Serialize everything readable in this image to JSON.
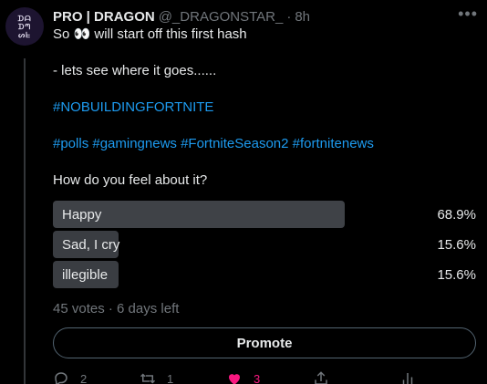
{
  "tweet": {
    "avatar_text": [
      "ᗪᗩ",
      "ᗪᘉ",
      "ᔕᖶ"
    ],
    "name": "PRO | DRAGON",
    "handle": "@_DRAGONSTAR_",
    "separator": "·",
    "time": "8h",
    "lines": [
      "So 👀 will start off this first hash",
      "",
      "- lets see where it goes......",
      ""
    ],
    "hashtag_line1": "#NOBUILDINGFORTNITE",
    "hashtag_line2": "#polls #gamingnews #FortniteSeason2  #fortnitenews",
    "question": "How do you feel about it?"
  },
  "poll": {
    "options": [
      {
        "label": "Happy",
        "percent_text": "68.9%",
        "percent": 68.9
      },
      {
        "label": "Sad, I cry",
        "percent_text": "15.6%",
        "percent": 15.6
      },
      {
        "label": "illegible",
        "percent_text": "15.6%",
        "percent": 15.6
      }
    ],
    "meta": "45 votes · 6 days left"
  },
  "promote_label": "Promote",
  "actions": {
    "reply_count": "2",
    "retweet_count": "1",
    "like_count": "3"
  },
  "colors": {
    "background": "#000000",
    "accent": "#1d9bf0",
    "like": "#f91880",
    "muted": "#71767b"
  },
  "icons": [
    "more-icon",
    "reply-icon",
    "retweet-icon",
    "heart-icon",
    "share-icon",
    "analytics-icon"
  ]
}
